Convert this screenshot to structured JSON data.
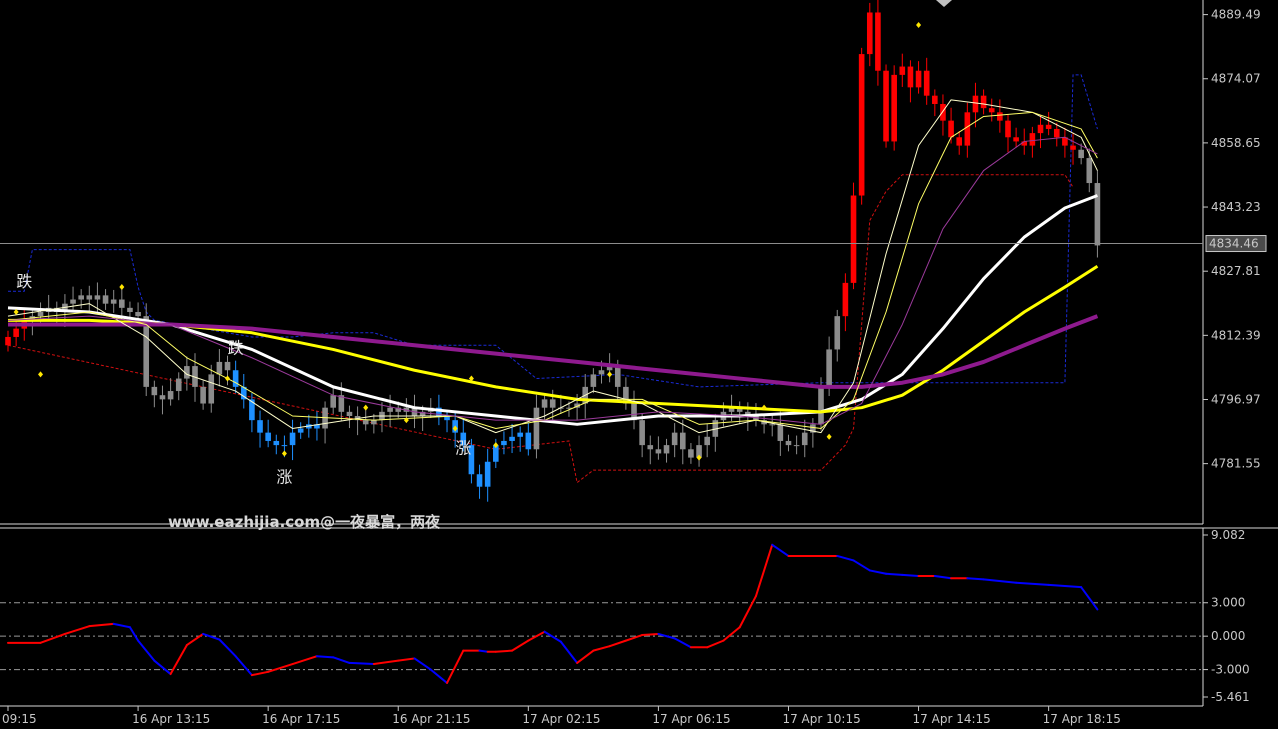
{
  "colors": {
    "background": "#000000",
    "axis": "#c8c8c8",
    "bull": "#ff0000",
    "bear_down": "#1e90ff",
    "neutral": "#8c8c8c",
    "ma_white": "#ffffff",
    "ma_yellow": "#ffff00",
    "ma_purple": "#8e1a8e",
    "channel": "#1a2bd6",
    "stop": "#d01010",
    "dot": "#ffe600"
  },
  "watermark": "www.eazhijia.com@一夜暴富，两夜",
  "chart_data": [
    {
      "type": "candlestick",
      "title": "",
      "xlabel": "",
      "ylabel": "",
      "ylim": [
        4768,
        4893
      ],
      "yticks": [
        "4889.49",
        "4874.07",
        "4858.65",
        "4843.23",
        "4827.81",
        "4812.39",
        "4796.97",
        "4781.55"
      ],
      "current_price_label": "4834.46",
      "current_price": 4834.46,
      "xticks": [
        "09:15",
        "16 Apr 13:15",
        "16 Apr 17:15",
        "16 Apr 21:15",
        "17 Apr 02:15",
        "17 Apr 06:15",
        "17 Apr 10:15",
        "17 Apr 14:15",
        "17 Apr 18:15"
      ],
      "xtick_bars": [
        0,
        16,
        32,
        48,
        64,
        80,
        96,
        112,
        128
      ],
      "annotations": [
        {
          "text": "跌",
          "bar": 2,
          "price": 4824
        },
        {
          "text": "跌",
          "bar": 28,
          "price": 4808
        },
        {
          "text": "涨",
          "bar": 34,
          "price": 4777
        },
        {
          "text": "涨",
          "bar": 56,
          "price": 4784
        }
      ],
      "candles": {
        "bars": 135,
        "close": [
          4812,
          4814,
          4816,
          4817,
          4818,
          4819,
          4818,
          4820,
          4821,
          4822,
          4821,
          4822,
          4820,
          4821,
          4819,
          4818,
          4817,
          4800,
          4798,
          4797,
          4799,
          4802,
          4805,
          4800,
          4796,
          4803,
          4806,
          4804,
          4800,
          4797,
          4792,
          4789,
          4787,
          4786,
          4786,
          4789,
          4790,
          4791,
          4790,
          4795,
          4798,
          4794,
          4793,
          4792,
          4791,
          4792,
          4794,
          4795,
          4794,
          4795,
          4793,
          4794,
          4795,
          4793,
          4792,
          4789,
          4786,
          4779,
          4776,
          4782,
          4786,
          4787,
          4788,
          4789,
          4785,
          4795,
          4797,
          4795,
          4795,
          4795,
          4796,
          4800,
          4803,
          4804,
          4805,
          4800,
          4796,
          4792,
          4786,
          4785,
          4784,
          4786,
          4789,
          4785,
          4783,
          4786,
          4788,
          4792,
          4794,
          4795,
          4794,
          4793,
          4792,
          4791,
          4791,
          4787,
          4786,
          4786,
          4789,
          4791,
          4800,
          4809,
          4817,
          4825,
          4846,
          4880,
          4890,
          4876,
          4859,
          4875,
          4877,
          4872,
          4876,
          4870,
          4868,
          4864,
          4860,
          4858,
          4866,
          4870,
          4867,
          4866,
          4864,
          4860,
          4859,
          4858,
          4861,
          4863,
          4862,
          4860,
          4858,
          4857,
          4855,
          4849,
          4834
        ],
        "open": [
          4810,
          4812,
          4814,
          4816,
          4817,
          4818,
          4819,
          4818,
          4820,
          4821,
          4822,
          4821,
          4822,
          4820,
          4821,
          4819,
          4818,
          4817,
          4800,
          4798,
          4797,
          4799,
          4802,
          4805,
          4800,
          4796,
          4803,
          4806,
          4804,
          4800,
          4797,
          4792,
          4789,
          4787,
          4786,
          4786,
          4789,
          4790,
          4791,
          4790,
          4795,
          4798,
          4794,
          4793,
          4792,
          4791,
          4792,
          4794,
          4795,
          4794,
          4795,
          4793,
          4794,
          4795,
          4793,
          4792,
          4789,
          4786,
          4779,
          4776,
          4782,
          4786,
          4787,
          4788,
          4789,
          4785,
          4795,
          4797,
          4795,
          4795,
          4795,
          4796,
          4800,
          4803,
          4804,
          4805,
          4800,
          4796,
          4792,
          4786,
          4785,
          4784,
          4786,
          4789,
          4785,
          4783,
          4786,
          4788,
          4792,
          4794,
          4795,
          4794,
          4793,
          4792,
          4791,
          4791,
          4787,
          4786,
          4786,
          4789,
          4791,
          4800,
          4809,
          4817,
          4825,
          4846,
          4880,
          4890,
          4876,
          4859,
          4875,
          4877,
          4872,
          4876,
          4870,
          4868,
          4864,
          4860,
          4858,
          4866,
          4870,
          4867,
          4866,
          4864,
          4860,
          4859,
          4858,
          4861,
          4863,
          4862,
          4860,
          4858,
          4857,
          4855,
          4849
        ]
      },
      "series": [
        {
          "color": "#ffffff",
          "width": 3,
          "x": [
            0,
            10,
            20,
            30,
            40,
            50,
            60,
            70,
            80,
            90,
            100,
            105,
            110,
            115,
            120,
            125,
            130,
            134
          ],
          "y": [
            4819,
            4818,
            4815,
            4809,
            4800,
            4795,
            4793,
            4791,
            4793,
            4793,
            4794,
            4797,
            4803,
            4814,
            4826,
            4836,
            4843,
            4846
          ]
        },
        {
          "color": "#ffff00",
          "width": 3,
          "x": [
            0,
            10,
            20,
            30,
            40,
            50,
            60,
            70,
            80,
            90,
            100,
            105,
            110,
            115,
            120,
            125,
            130,
            134
          ],
          "y": [
            4816,
            4816,
            4815,
            4813,
            4809,
            4804,
            4800,
            4797,
            4796,
            4795,
            4794,
            4795,
            4798,
            4804,
            4811,
            4818,
            4824,
            4829
          ]
        },
        {
          "color": "#8e1a8e",
          "width": 4,
          "x": [
            0,
            10,
            20,
            30,
            40,
            50,
            60,
            70,
            80,
            90,
            100,
            105,
            110,
            115,
            120,
            125,
            130,
            134
          ],
          "y": [
            4815,
            4815,
            4815,
            4814,
            4812,
            4810,
            4808,
            4806,
            4804,
            4802,
            4800,
            4800,
            4801,
            4803,
            4806,
            4810,
            4814,
            4817
          ]
        },
        {
          "color": "#ffffcc",
          "width": 1,
          "x": [
            0,
            10,
            17,
            22,
            28,
            35,
            45,
            55,
            60,
            66,
            72,
            78,
            85,
            92,
            100,
            104,
            108,
            112,
            116,
            120,
            126,
            132,
            134
          ],
          "y": [
            4817,
            4820,
            4812,
            4803,
            4799,
            4790,
            4793,
            4793,
            4789,
            4793,
            4799,
            4796,
            4789,
            4792,
            4789,
            4801,
            4832,
            4858,
            4869,
            4868,
            4866,
            4860,
            4852
          ]
        },
        {
          "color": "#ffff66",
          "width": 1,
          "x": [
            0,
            10,
            17,
            22,
            28,
            35,
            45,
            55,
            60,
            66,
            72,
            78,
            85,
            92,
            100,
            104,
            108,
            112,
            116,
            120,
            126,
            132,
            134
          ],
          "y": [
            4816,
            4818,
            4815,
            4807,
            4801,
            4793,
            4792,
            4793,
            4790,
            4792,
            4797,
            4797,
            4791,
            4792,
            4790,
            4797,
            4818,
            4844,
            4860,
            4865,
            4866,
            4862,
            4855
          ]
        },
        {
          "color": "#9b3a9b",
          "width": 1,
          "x": [
            0,
            10,
            20,
            30,
            40,
            50,
            60,
            70,
            80,
            90,
            100,
            105,
            110,
            115,
            120,
            125,
            130,
            134
          ],
          "y": [
            4816,
            4817,
            4815,
            4807,
            4798,
            4794,
            4792,
            4792,
            4794,
            4793,
            4791,
            4796,
            4815,
            4838,
            4852,
            4859,
            4860,
            4856
          ]
        }
      ],
      "channel_upper": {
        "x": [
          0,
          2,
          3,
          15,
          16,
          17,
          18,
          30,
          35,
          40,
          45,
          50,
          56,
          60,
          65,
          75,
          85,
          100,
          108,
          112,
          125,
          130,
          131,
          132,
          134
        ],
        "y": [
          4823,
          4823,
          4833,
          4833,
          4824,
          4818,
          4816,
          4812,
          4812,
          4813,
          4813,
          4810,
          4810,
          4810,
          4802,
          4803,
          4800,
          4801,
          4801,
          4801,
          4801,
          4801,
          4875,
          4875,
          4862
        ]
      },
      "stop_line": {
        "x": [
          0,
          60,
          69,
          70,
          72,
          80,
          90,
          98,
          100,
          103,
          104,
          106,
          108,
          110,
          130,
          131
        ],
        "y": [
          4810,
          4785,
          4787,
          4777,
          4780,
          4780,
          4780,
          4780,
          4780,
          4786,
          4790,
          4840,
          4847,
          4851,
          4851,
          4848
        ]
      },
      "dots": [
        {
          "bar": 1,
          "price": 4818
        },
        {
          "bar": 4,
          "price": 4803
        },
        {
          "bar": 14,
          "price": 4824
        },
        {
          "bar": 27,
          "price": 4802
        },
        {
          "bar": 34,
          "price": 4784
        },
        {
          "bar": 44,
          "price": 4795
        },
        {
          "bar": 49,
          "price": 4792
        },
        {
          "bar": 55,
          "price": 4790
        },
        {
          "bar": 57,
          "price": 4802
        },
        {
          "bar": 60,
          "price": 4786
        },
        {
          "bar": 74,
          "price": 4803
        },
        {
          "bar": 85,
          "price": 4783
        },
        {
          "bar": 93,
          "price": 4795
        },
        {
          "bar": 101,
          "price": 4788
        },
        {
          "bar": 112,
          "price": 4887
        }
      ]
    },
    {
      "type": "line",
      "title": "",
      "xlabel": "",
      "ylabel": "",
      "ylim": [
        -5.461,
        9.082
      ],
      "yticks": [
        "9.082",
        "3.000",
        "0.000",
        "-3.000",
        "-5.461"
      ],
      "levels": [
        3,
        0,
        -3
      ],
      "up_color": "#ff0000",
      "down_color": "#0000ff",
      "x": [
        0,
        4,
        7,
        10,
        13,
        15,
        16,
        18,
        20,
        22,
        24,
        26,
        28,
        30,
        32,
        35,
        38,
        40,
        42,
        45,
        48,
        50,
        52,
        54,
        56,
        58,
        59,
        60,
        62,
        64,
        66,
        68,
        70,
        72,
        74,
        76,
        78,
        80,
        82,
        84,
        86,
        88,
        90,
        92,
        94,
        96,
        98,
        100,
        102,
        104,
        106,
        108,
        110,
        112,
        114,
        116,
        118,
        120,
        124,
        128,
        132,
        134
      ],
      "y": [
        -0.6,
        -0.6,
        0.2,
        0.9,
        1.1,
        0.8,
        -0.4,
        -2.2,
        -3.4,
        -0.8,
        0.2,
        -0.3,
        -1.8,
        -3.5,
        -3.2,
        -2.5,
        -1.8,
        -1.9,
        -2.4,
        -2.5,
        -2.2,
        -2.0,
        -3.0,
        -4.2,
        -1.3,
        -1.3,
        -1.4,
        -1.4,
        -1.3,
        -0.4,
        0.4,
        -0.5,
        -2.4,
        -1.3,
        -0.9,
        -0.4,
        0.1,
        0.2,
        -0.2,
        -1.0,
        -1.0,
        -0.4,
        0.8,
        3.6,
        8.2,
        7.2,
        7.2,
        7.2,
        7.2,
        6.8,
        5.9,
        5.6,
        5.5,
        5.4,
        5.4,
        5.2,
        5.2,
        5.1,
        4.8,
        4.6,
        4.4,
        2.4
      ]
    }
  ]
}
